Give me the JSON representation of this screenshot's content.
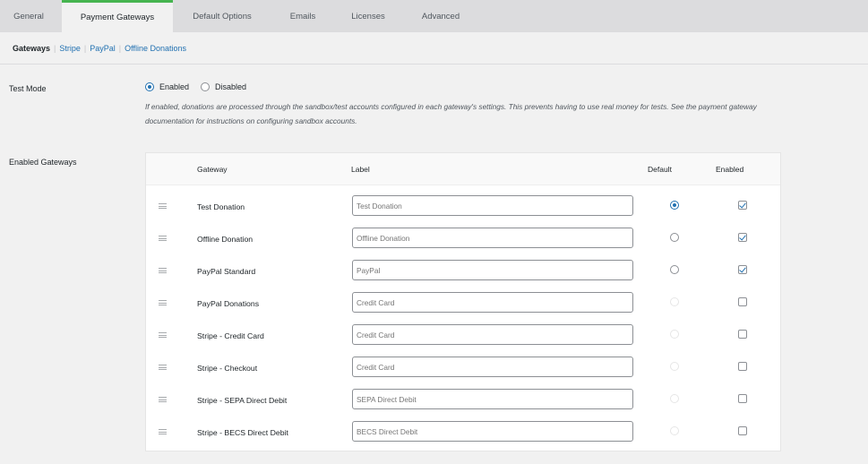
{
  "tabs": [
    {
      "label": "General",
      "active": false
    },
    {
      "label": "Payment Gateways",
      "active": true
    },
    {
      "label": "Default Options",
      "active": false
    },
    {
      "label": "Emails",
      "active": false
    },
    {
      "label": "Licenses",
      "active": false
    },
    {
      "label": "Advanced",
      "active": false
    }
  ],
  "subnav": {
    "current": "Gateways",
    "links": [
      "Stripe",
      "PayPal",
      "Offline Donations"
    ]
  },
  "test_mode": {
    "label": "Test Mode",
    "options": [
      {
        "label": "Enabled",
        "selected": true
      },
      {
        "label": "Disabled",
        "selected": false
      }
    ],
    "description": "If enabled, donations are processed through the sandbox/test accounts configured in each gateway's settings. This prevents having to use real money for tests. See the payment gateway documentation for instructions on configuring sandbox accounts."
  },
  "enabled_gateways": {
    "label": "Enabled Gateways",
    "columns": {
      "gateway": "Gateway",
      "label": "Label",
      "default": "Default",
      "enabled": "Enabled"
    },
    "rows": [
      {
        "gateway": "Test Donation",
        "placeholder": "Test Donation",
        "default": "selected",
        "enabled": true
      },
      {
        "gateway": "Offline Donation",
        "placeholder": "Offline Donation",
        "default": "available",
        "enabled": true
      },
      {
        "gateway": "PayPal Standard",
        "placeholder": "PayPal",
        "default": "available",
        "enabled": true
      },
      {
        "gateway": "PayPal Donations",
        "placeholder": "Credit Card",
        "default": "disabled",
        "enabled": false
      },
      {
        "gateway": "Stripe - Credit Card",
        "placeholder": "Credit Card",
        "default": "disabled",
        "enabled": false
      },
      {
        "gateway": "Stripe - Checkout",
        "placeholder": "Credit Card",
        "default": "disabled",
        "enabled": false
      },
      {
        "gateway": "Stripe - SEPA Direct Debit",
        "placeholder": "SEPA Direct Debit",
        "default": "disabled",
        "enabled": false
      },
      {
        "gateway": "Stripe - BECS Direct Debit",
        "placeholder": "BECS Direct Debit",
        "default": "disabled",
        "enabled": false
      }
    ]
  },
  "icons": {
    "drag_handle": "drag-handle-icon"
  },
  "colors": {
    "accent": "#2271b1",
    "active_tab_border": "#46b450"
  }
}
